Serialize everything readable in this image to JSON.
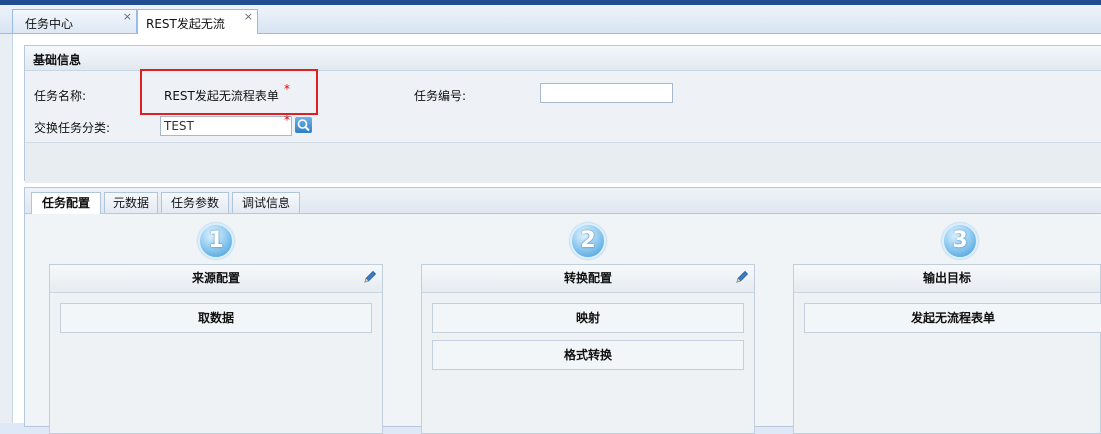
{
  "tabs": [
    {
      "label": "任务中心",
      "close": "×"
    },
    {
      "label": "REST发起无流",
      "close": "×"
    }
  ],
  "basic_info": {
    "title": "基础信息",
    "task_name_label": "任务名称:",
    "task_name_value": "REST发起无流程表单",
    "task_no_label": "任务编号:",
    "task_no_value": "",
    "category_label": "交换任务分类:",
    "category_value": "TEST",
    "required_mark": "*"
  },
  "sub_tabs": [
    "任务配置",
    "元数据",
    "任务参数",
    "调试信息"
  ],
  "steps": [
    {
      "number": "1",
      "title": "来源配置",
      "items": [
        "取数据"
      ],
      "editable": true
    },
    {
      "number": "2",
      "title": "转换配置",
      "items": [
        "映射",
        "格式转换"
      ],
      "editable": true
    },
    {
      "number": "3",
      "title": "输出目标",
      "items": [
        "发起无流程表单"
      ],
      "editable": false
    }
  ],
  "colors": {
    "highlight": "#e02020",
    "header_bar": "#1f4d8f",
    "step_circle": "#3a97d6"
  }
}
